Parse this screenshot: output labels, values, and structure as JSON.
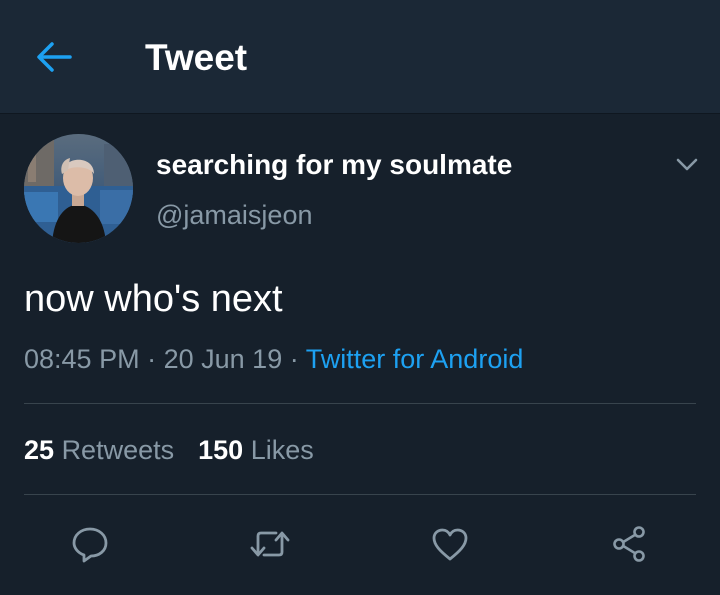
{
  "header": {
    "title": "Tweet",
    "back_icon": "arrow-left-icon",
    "accent": "#1da1f2"
  },
  "tweet": {
    "display_name": "searching for my soulmate",
    "handle": "@jamaisjeon",
    "text": "now who's next",
    "time": "08:45 PM",
    "separator": "·",
    "date": "20 Jun 19",
    "source": "Twitter for Android"
  },
  "stats": {
    "retweets_count": "25",
    "retweets_label": "Retweets",
    "likes_count": "150",
    "likes_label": "Likes"
  },
  "actions": [
    {
      "icon": "reply-icon"
    },
    {
      "icon": "retweet-icon"
    },
    {
      "icon": "like-heart-icon"
    },
    {
      "icon": "share-icon"
    }
  ],
  "colors": {
    "background": "#16202b",
    "header_background": "#1b2836",
    "secondary_text": "#8899a6",
    "link": "#1da1f2",
    "divider": "#38444d"
  }
}
